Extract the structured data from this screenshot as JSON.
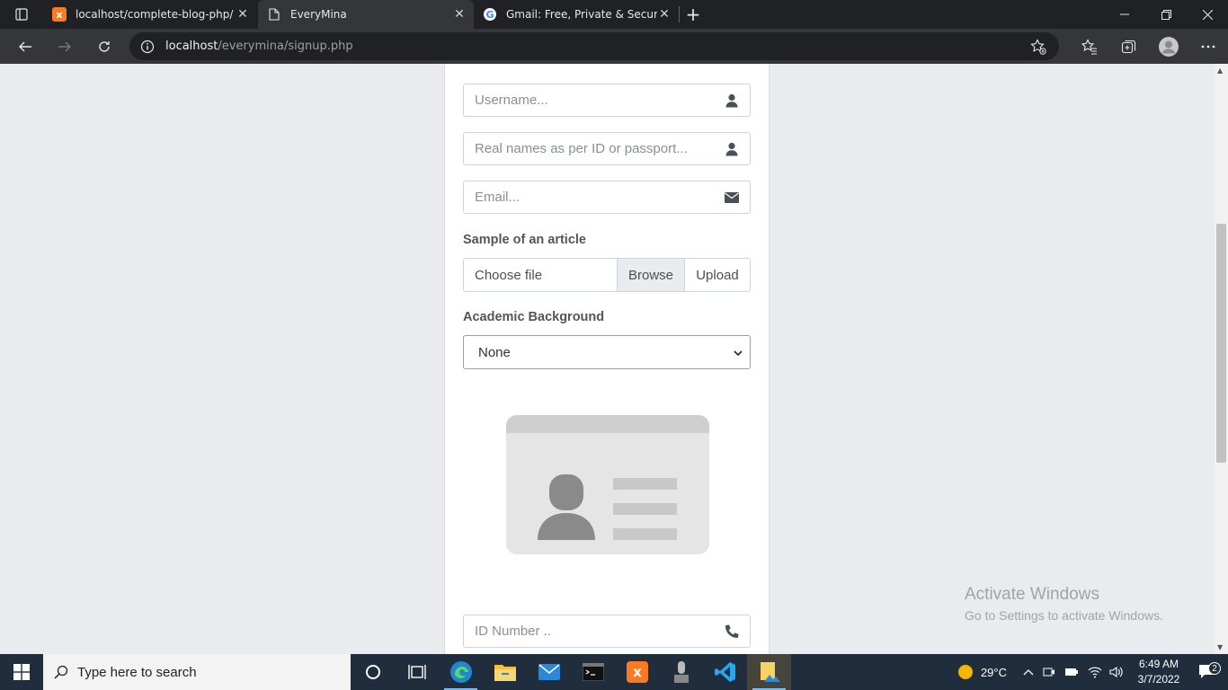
{
  "browser": {
    "tabs": [
      {
        "title": "localhost/complete-blog-php/",
        "favicon": "xampp-icon",
        "active": false
      },
      {
        "title": "EveryMina",
        "favicon": "page-icon",
        "active": true
      },
      {
        "title": "Gmail: Free, Private & Secure Em",
        "favicon": "google-icon",
        "active": false
      }
    ],
    "url_host": "localhost",
    "url_path": "/everymina/signup.php"
  },
  "form": {
    "username_placeholder": "Username...",
    "realname_placeholder": "Real names as per ID or passport...",
    "email_placeholder": "Email...",
    "article_label": "Sample of an article",
    "file_choose": "Choose file",
    "file_browse": "Browse",
    "file_upload": "Upload",
    "academic_label": "Academic Background",
    "academic_selected": "None",
    "id_number_placeholder": "ID Number .."
  },
  "watermark": {
    "line1": "Activate Windows",
    "line2": "Go to Settings to activate Windows."
  },
  "taskbar": {
    "search_placeholder": "Type here to search",
    "weather": "29°C",
    "time": "6:49 AM",
    "date": "3/7/2022",
    "notifications": "2"
  },
  "colors": {
    "page_bg": "#e9ecef",
    "chrome_dark": "#202124",
    "taskbar": "#1f2d3d"
  }
}
